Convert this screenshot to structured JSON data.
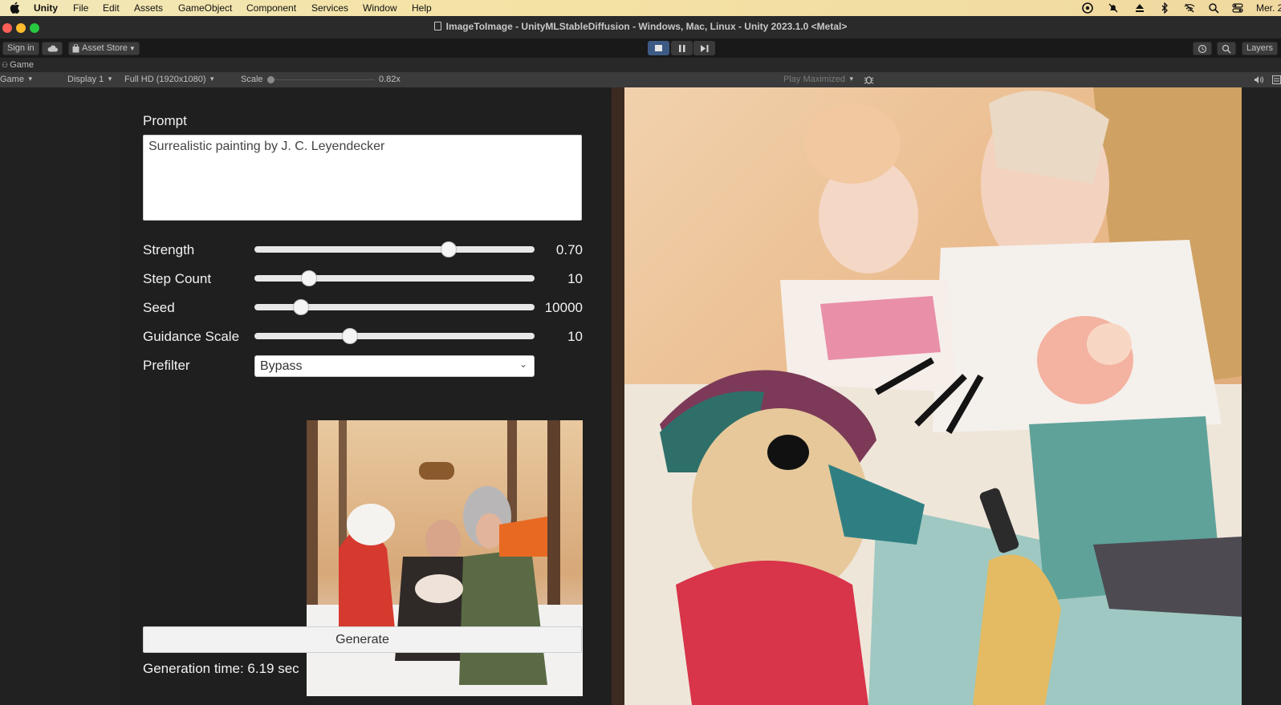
{
  "menubar": {
    "app_name": "Unity",
    "items": [
      "File",
      "Edit",
      "Assets",
      "GameObject",
      "Component",
      "Services",
      "Window",
      "Help"
    ],
    "clock": "Mer. 2",
    "status_icons": [
      "creative-cloud-icon",
      "notifications-muted-icon",
      "eject-icon",
      "bluetooth-icon",
      "wifi-off-icon",
      "spotlight-search-icon",
      "control-center-icon"
    ]
  },
  "window": {
    "title": "ImageToImage - UnityMLStableDiffusion - Windows, Mac, Linux - Unity 2023.1.0 <Metal>"
  },
  "toolbar": {
    "sign_in": "Sign in",
    "asset_store": "Asset Store",
    "layers": "Layers"
  },
  "game_tab": {
    "label": "Game"
  },
  "game_toolbar": {
    "view_mode": "Game",
    "display": "Display 1",
    "resolution": "Full HD (1920x1080)",
    "scale_label": "Scale",
    "scale_value": "0.82x",
    "play_mode": "Play Maximized",
    "scale_level": 0.0
  },
  "panel": {
    "prompt_label": "Prompt",
    "prompt_value": "Surrealistic painting by J. C. Leyendecker",
    "sliders": [
      {
        "label": "Strength",
        "value": "0.70",
        "level": 0.7
      },
      {
        "label": "Step Count",
        "value": "10",
        "level": 0.19
      },
      {
        "label": "Seed",
        "value": "10000",
        "level": 0.16
      },
      {
        "label": "Guidance Scale",
        "value": "10",
        "level": 0.34
      }
    ],
    "prefilter_label": "Prefilter",
    "prefilter_value": "Bypass",
    "generate_label": "Generate",
    "generation_time": "Generation time: 6.19 sec"
  },
  "colors": {
    "menubar_bg": "#f3e3a8",
    "play_active": "#3d5a85",
    "panel_bg": "#1f1f1f"
  }
}
